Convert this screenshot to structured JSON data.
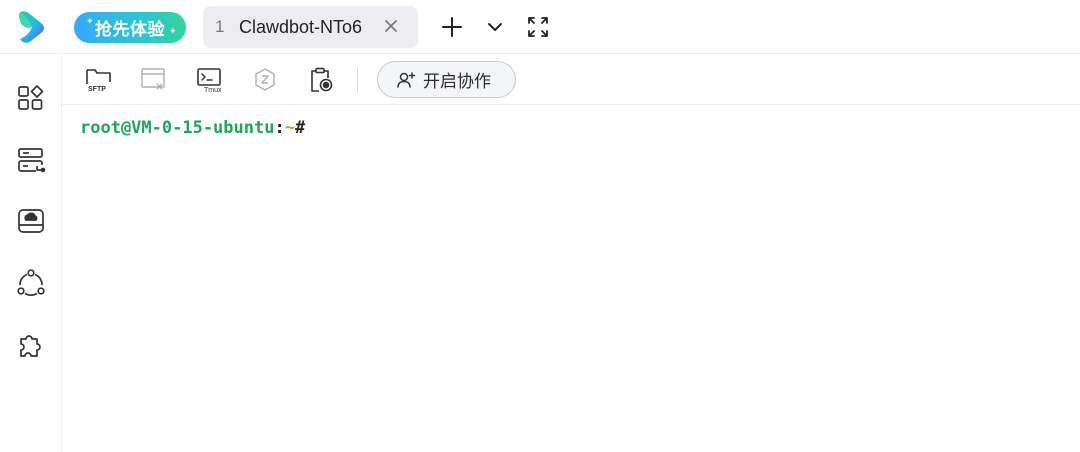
{
  "header": {
    "beta_label": "抢先体验",
    "tab": {
      "number": "1",
      "title": "Clawdbot-NTo6"
    }
  },
  "sidebar": {
    "items": [
      {
        "icon": "apps-grid-icon"
      },
      {
        "icon": "server-list-icon"
      },
      {
        "icon": "cloud-drive-icon"
      },
      {
        "icon": "network-nodes-icon"
      },
      {
        "icon": "puzzle-plugin-icon"
      }
    ]
  },
  "toolbar": {
    "sftp_label": "SFTP",
    "tmux_label": "Tmux",
    "collab_label": "开启协作"
  },
  "terminal": {
    "user_host": "root@VM-0-15-ubuntu",
    "colon": ":",
    "path": "~",
    "symbol": "#"
  },
  "colors": {
    "accent_green": "#1ea65a",
    "path_orange": "#d49a00",
    "beta_gradient_start": "#35a8ff",
    "beta_gradient_end": "#30d59a"
  }
}
